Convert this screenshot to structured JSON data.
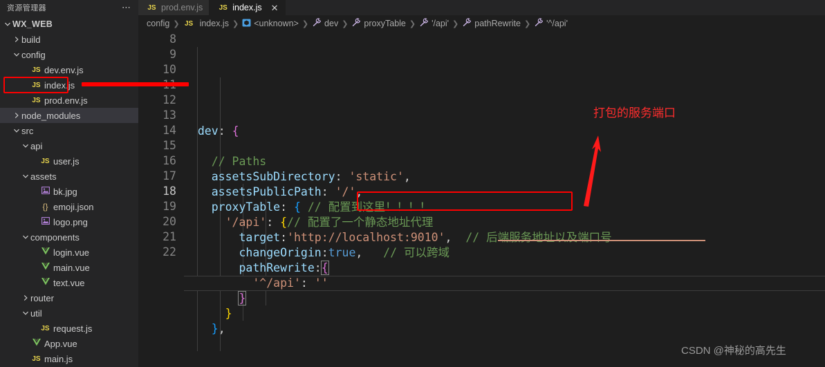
{
  "sidebar": {
    "header_title": "资源管理器",
    "more_icon": "ellipsis-icon",
    "items": [
      {
        "label": "WX_WEB",
        "type": "root",
        "indent": 0,
        "expanded": true,
        "icon": "chevron-down-icon"
      },
      {
        "label": "build",
        "type": "folder",
        "indent": 1,
        "expanded": false,
        "icon": "chevron-right-icon"
      },
      {
        "label": "config",
        "type": "folder",
        "indent": 1,
        "expanded": true,
        "icon": "chevron-down-icon"
      },
      {
        "label": "dev.env.js",
        "type": "js",
        "indent": 2,
        "icon": "js-file-icon"
      },
      {
        "label": "index.js",
        "type": "js",
        "indent": 2,
        "icon": "js-file-icon",
        "highlighted": true
      },
      {
        "label": "prod.env.js",
        "type": "js",
        "indent": 2,
        "icon": "js-file-icon"
      },
      {
        "label": "node_modules",
        "type": "folder",
        "indent": 1,
        "expanded": false,
        "icon": "chevron-right-icon",
        "selected": true
      },
      {
        "label": "src",
        "type": "folder",
        "indent": 1,
        "expanded": true,
        "icon": "chevron-down-icon"
      },
      {
        "label": "api",
        "type": "folder",
        "indent": 2,
        "expanded": true,
        "icon": "chevron-down-icon"
      },
      {
        "label": "user.js",
        "type": "js",
        "indent": 3,
        "icon": "js-file-icon"
      },
      {
        "label": "assets",
        "type": "folder",
        "indent": 2,
        "expanded": true,
        "icon": "chevron-down-icon"
      },
      {
        "label": "bk.jpg",
        "type": "img",
        "indent": 3,
        "icon": "image-file-icon"
      },
      {
        "label": "emoji.json",
        "type": "json",
        "indent": 3,
        "icon": "json-file-icon"
      },
      {
        "label": "logo.png",
        "type": "img",
        "indent": 3,
        "icon": "image-file-icon"
      },
      {
        "label": "components",
        "type": "folder",
        "indent": 2,
        "expanded": true,
        "icon": "chevron-down-icon"
      },
      {
        "label": "login.vue",
        "type": "vue",
        "indent": 3,
        "icon": "vue-file-icon"
      },
      {
        "label": "main.vue",
        "type": "vue",
        "indent": 3,
        "icon": "vue-file-icon"
      },
      {
        "label": "text.vue",
        "type": "vue",
        "indent": 3,
        "icon": "vue-file-icon"
      },
      {
        "label": "router",
        "type": "folder",
        "indent": 2,
        "expanded": false,
        "icon": "chevron-right-icon"
      },
      {
        "label": "util",
        "type": "folder",
        "indent": 2,
        "expanded": true,
        "icon": "chevron-down-icon"
      },
      {
        "label": "request.js",
        "type": "js",
        "indent": 3,
        "icon": "js-file-icon"
      },
      {
        "label": "App.vue",
        "type": "vue",
        "indent": 2,
        "icon": "vue-file-icon"
      },
      {
        "label": "main.js",
        "type": "js",
        "indent": 2,
        "icon": "js-file-icon"
      }
    ]
  },
  "tabs": [
    {
      "label": "prod.env.js",
      "icon": "js-file-icon",
      "active": false,
      "closable": false
    },
    {
      "label": "index.js",
      "icon": "js-file-icon",
      "active": true,
      "closable": true,
      "close_icon": "close-icon"
    }
  ],
  "breadcrumbs": [
    {
      "label": "config",
      "icon": ""
    },
    {
      "label": "index.js",
      "icon": "js-file-icon"
    },
    {
      "label": "<unknown>",
      "icon": "module-symbol-icon"
    },
    {
      "label": "dev",
      "icon": "property-symbol-icon"
    },
    {
      "label": "proxyTable",
      "icon": "property-symbol-icon"
    },
    {
      "label": "'/api'",
      "icon": "property-symbol-icon"
    },
    {
      "label": "pathRewrite",
      "icon": "property-symbol-icon"
    },
    {
      "label": "'^/api'",
      "icon": "property-symbol-icon"
    }
  ],
  "code": {
    "first_line_number": 8,
    "active_line_number": 18,
    "lines": [
      {
        "n": 8,
        "tokens": [
          {
            "t": "  ",
            "c": "ws"
          },
          {
            "t": "dev",
            "c": "prop"
          },
          {
            "t": ": ",
            "c": "punct"
          },
          {
            "t": "{",
            "c": "b1"
          }
        ]
      },
      {
        "n": 9,
        "tokens": []
      },
      {
        "n": 10,
        "tokens": [
          {
            "t": "    ",
            "c": "ws"
          },
          {
            "t": "// Paths",
            "c": "com"
          }
        ]
      },
      {
        "n": 11,
        "tokens": [
          {
            "t": "    ",
            "c": "ws"
          },
          {
            "t": "assetsSubDirectory",
            "c": "prop"
          },
          {
            "t": ": ",
            "c": "punct"
          },
          {
            "t": "'static'",
            "c": "str"
          },
          {
            "t": ",",
            "c": "punct"
          }
        ]
      },
      {
        "n": 12,
        "tokens": [
          {
            "t": "    ",
            "c": "ws"
          },
          {
            "t": "assetsPublicPath",
            "c": "prop"
          },
          {
            "t": ": ",
            "c": "punct"
          },
          {
            "t": "'/'",
            "c": "str"
          },
          {
            "t": ",",
            "c": "punct"
          }
        ]
      },
      {
        "n": 13,
        "tokens": [
          {
            "t": "    ",
            "c": "ws"
          },
          {
            "t": "proxyTable",
            "c": "prop"
          },
          {
            "t": ": ",
            "c": "punct"
          },
          {
            "t": "{",
            "c": "b2"
          },
          {
            "t": " ",
            "c": "ws"
          },
          {
            "t": "// 配置到这里！！！！",
            "c": "com"
          }
        ]
      },
      {
        "n": 14,
        "tokens": [
          {
            "t": "      ",
            "c": "ws"
          },
          {
            "t": "'/api'",
            "c": "str"
          },
          {
            "t": ": ",
            "c": "punct"
          },
          {
            "t": "{",
            "c": "b3"
          },
          {
            "t": "// 配置了一个静态地址代理",
            "c": "com"
          }
        ]
      },
      {
        "n": 15,
        "tokens": [
          {
            "t": "        ",
            "c": "ws"
          },
          {
            "t": "target",
            "c": "prop"
          },
          {
            "t": ":",
            "c": "punct"
          },
          {
            "t": "'http://localhost:9010'",
            "c": "str"
          },
          {
            "t": ",",
            "c": "punct"
          },
          {
            "t": "  ",
            "c": "ws"
          },
          {
            "t": "// 后端服务地址以及端口号",
            "c": "com"
          }
        ]
      },
      {
        "n": 16,
        "tokens": [
          {
            "t": "        ",
            "c": "ws"
          },
          {
            "t": "changeOrigin",
            "c": "prop"
          },
          {
            "t": ":",
            "c": "punct"
          },
          {
            "t": "true",
            "c": "kw"
          },
          {
            "t": ",",
            "c": "punct"
          },
          {
            "t": "   ",
            "c": "ws"
          },
          {
            "t": "// 可以跨域",
            "c": "com"
          }
        ]
      },
      {
        "n": 17,
        "tokens": [
          {
            "t": "        ",
            "c": "ws"
          },
          {
            "t": "pathRewrite",
            "c": "prop"
          },
          {
            "t": ":",
            "c": "punct"
          },
          {
            "t": "{",
            "c": "b1 bracket-match"
          }
        ]
      },
      {
        "n": 18,
        "tokens": [
          {
            "t": "          ",
            "c": "ws"
          },
          {
            "t": "'^/api'",
            "c": "str"
          },
          {
            "t": ": ",
            "c": "punct"
          },
          {
            "t": "''",
            "c": "str"
          }
        ],
        "active": true
      },
      {
        "n": 19,
        "tokens": [
          {
            "t": "        ",
            "c": "ws"
          },
          {
            "t": "}",
            "c": "b1 bracket-match"
          }
        ]
      },
      {
        "n": 20,
        "tokens": [
          {
            "t": "      ",
            "c": "ws"
          },
          {
            "t": "}",
            "c": "b3"
          }
        ]
      },
      {
        "n": 21,
        "tokens": [
          {
            "t": "    ",
            "c": "ws"
          },
          {
            "t": "}",
            "c": "b2"
          },
          {
            "t": ",",
            "c": "punct"
          }
        ]
      },
      {
        "n": 22,
        "tokens": []
      }
    ]
  },
  "annotations": {
    "red_note": "打包的服务端口",
    "red_box_target": "http://localhost:9010",
    "red_box_sidebar_file": "index.js",
    "arrow": "red-arrow-up",
    "watermark": "CSDN @神秘的高先生"
  },
  "colors": {
    "editor_bg": "#1e1e1e",
    "sidebar_bg": "#252526",
    "tab_inactive_bg": "#2d2d2d",
    "accent_red": "#ff0000",
    "string": "#ce9178",
    "property": "#9cdcfe",
    "comment": "#6a9955",
    "keyword": "#569cd6"
  }
}
